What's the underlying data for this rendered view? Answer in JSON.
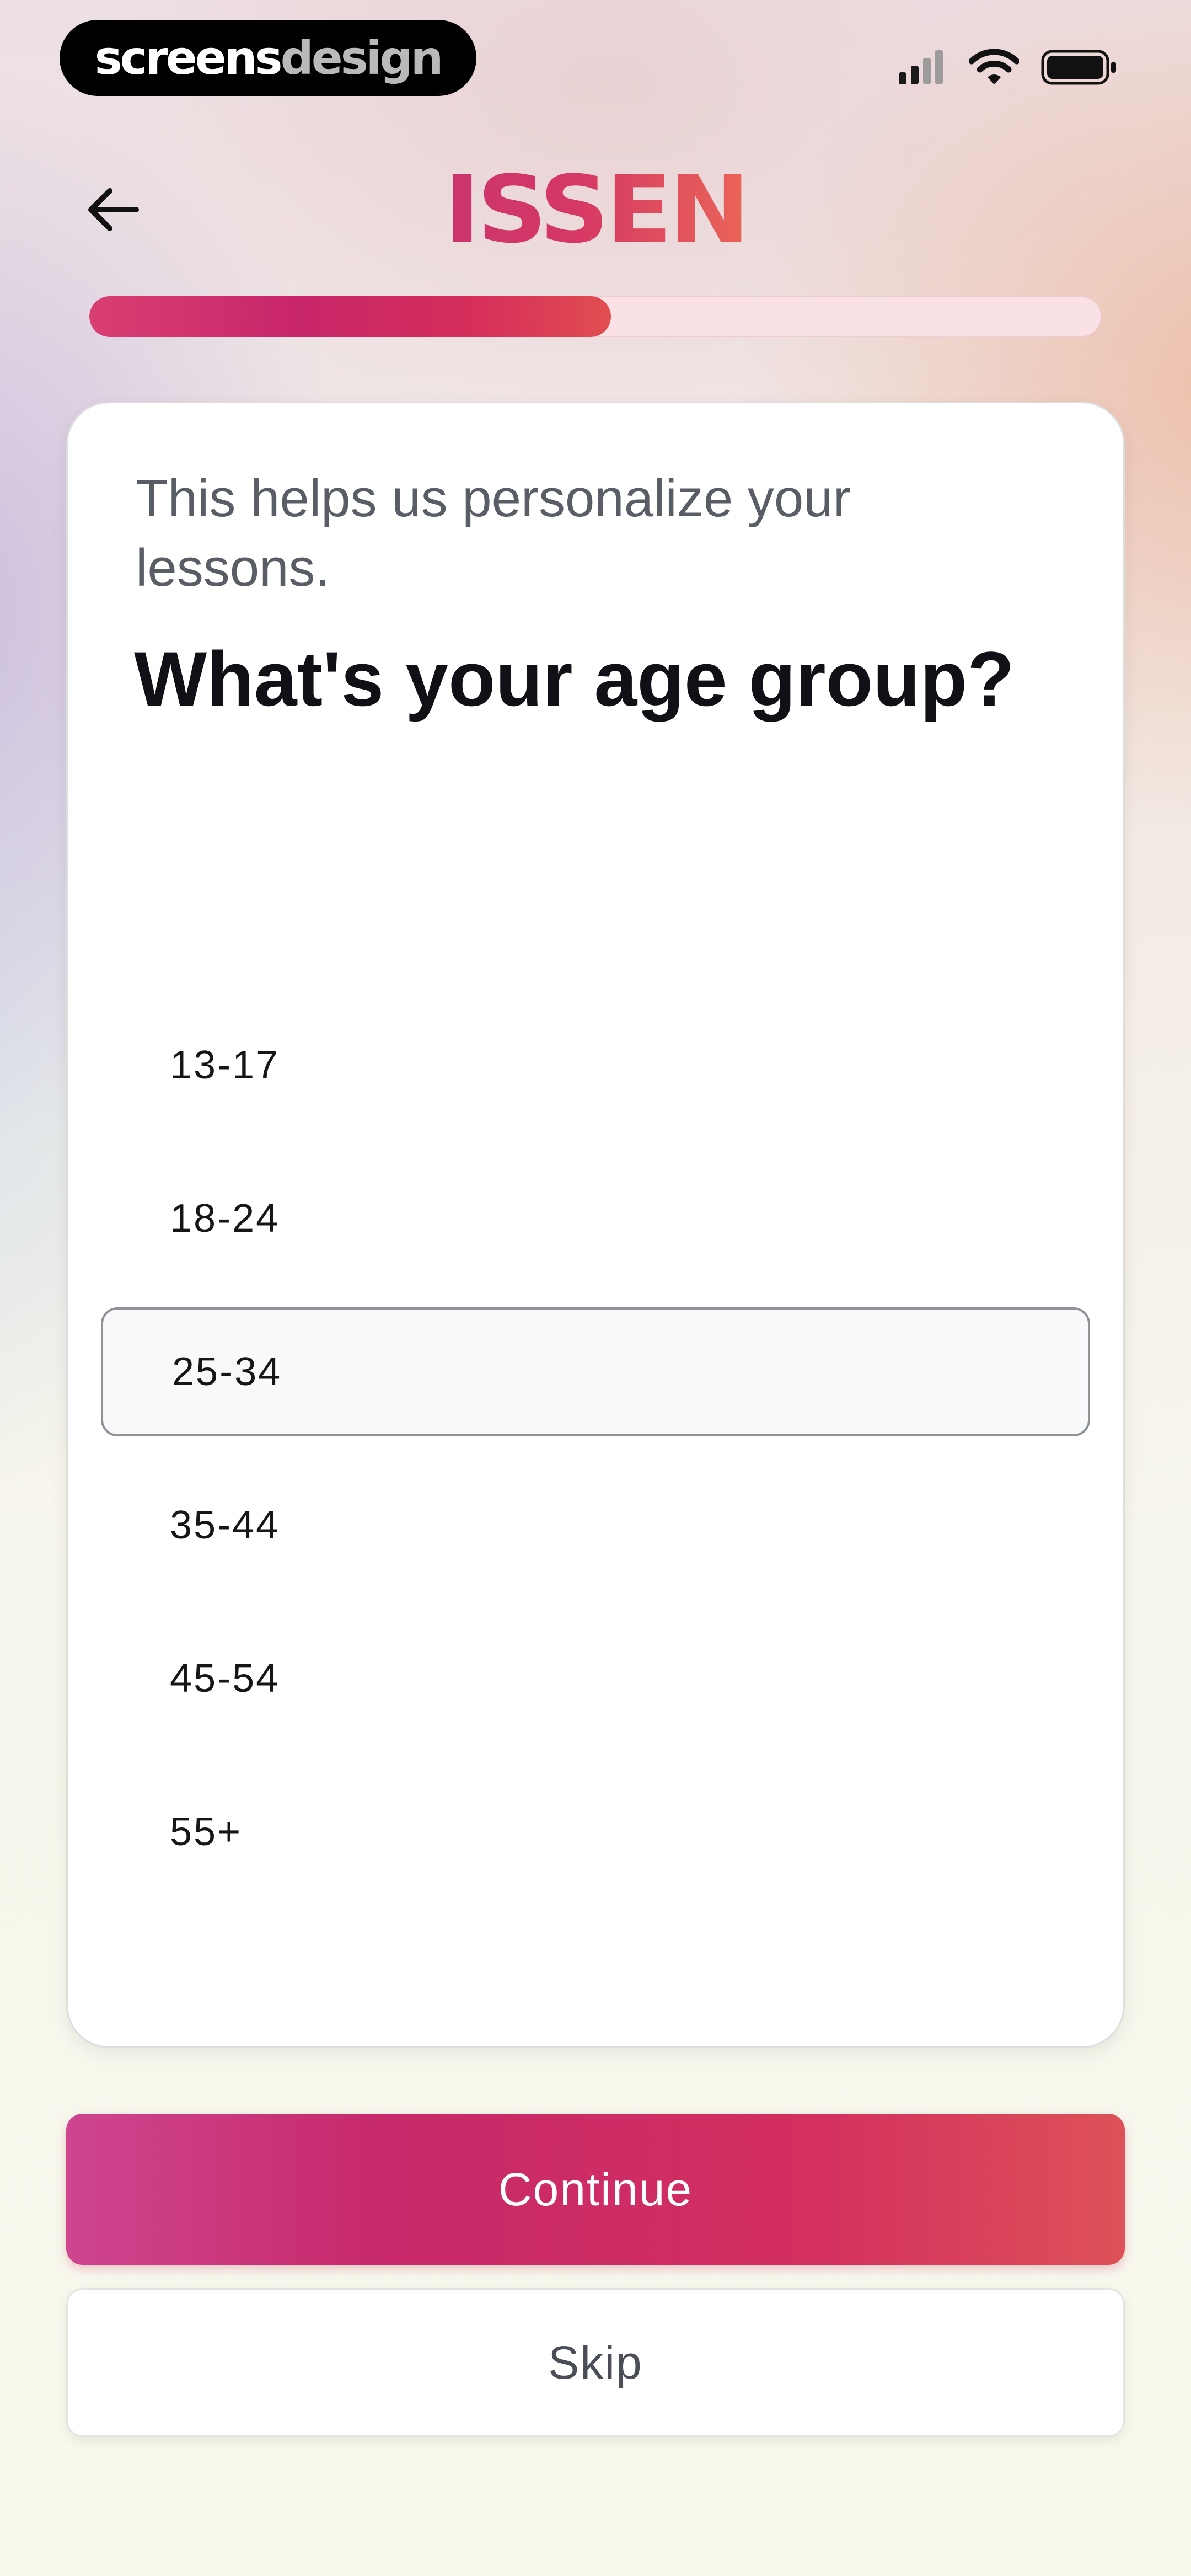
{
  "status_bar": {
    "watermark_part1": "screens",
    "watermark_part2": "design"
  },
  "header": {
    "logo_text": "ISSEN",
    "progress_fraction": 0.515
  },
  "card": {
    "subtitle": "This helps us personalize your lessons.",
    "question": "What's your age group?",
    "options": [
      {
        "label": "13-17",
        "selected": false
      },
      {
        "label": "18-24",
        "selected": false
      },
      {
        "label": "25-34",
        "selected": true
      },
      {
        "label": "35-44",
        "selected": false
      },
      {
        "label": "45-54",
        "selected": false
      },
      {
        "label": "55+",
        "selected": false
      }
    ]
  },
  "actions": {
    "continue_label": "Continue",
    "skip_label": "Skip"
  },
  "colors": {
    "accent": "#d32f5f",
    "progress_track": "#fae1e6"
  }
}
